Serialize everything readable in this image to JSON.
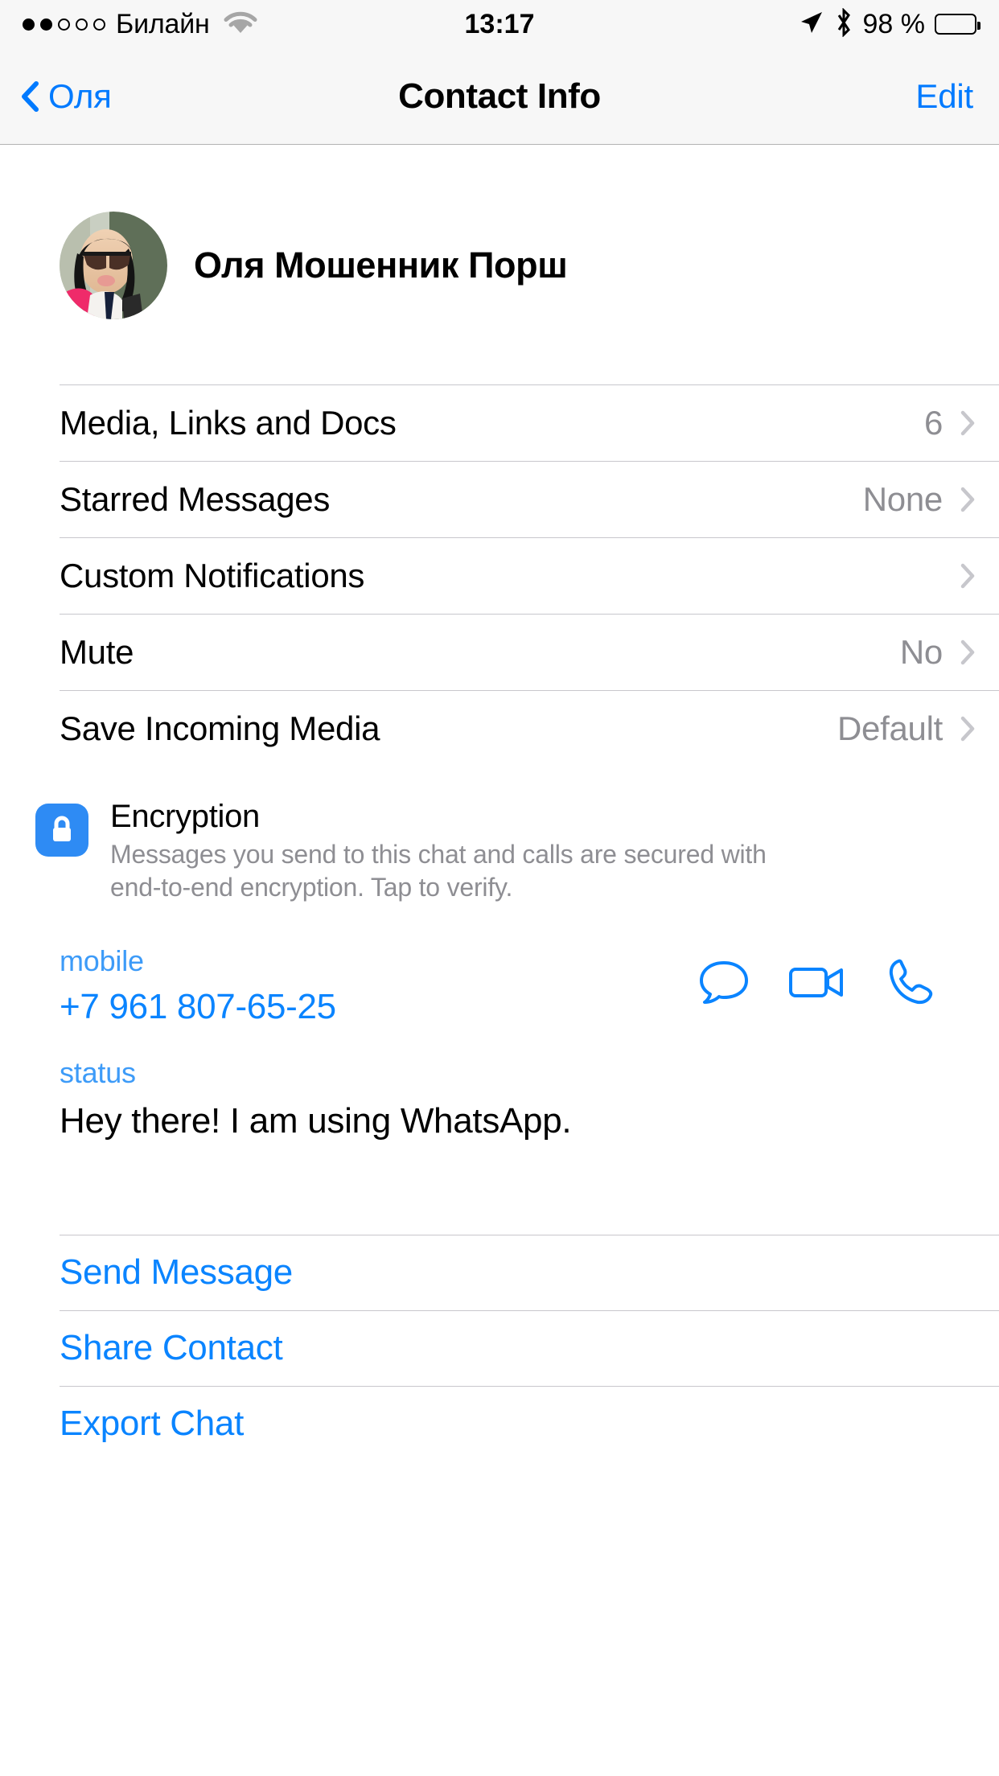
{
  "status_bar": {
    "signal_dots_filled": 2,
    "signal_dots_total": 5,
    "carrier": "Билайн",
    "wifi_icon": "wifi-icon",
    "time": "13:17",
    "location_icon": "location-arrow-icon",
    "bluetooth_icon": "bluetooth-icon",
    "battery_percent": "98 %",
    "battery_icon": "battery-full-icon"
  },
  "nav_bar": {
    "back_icon": "chevron-left-icon",
    "back_label": "Оля",
    "title": "Contact Info",
    "edit_label": "Edit"
  },
  "contact": {
    "avatar_name": "avatar",
    "name": "Оля Мошенник Порш"
  },
  "rows": [
    {
      "label": "Media, Links and Docs",
      "value": "6",
      "chevron": "chevron-right-icon"
    },
    {
      "label": "Starred Messages",
      "value": "None",
      "chevron": "chevron-right-icon"
    },
    {
      "label": "Custom Notifications",
      "value": "",
      "chevron": "chevron-right-icon"
    },
    {
      "label": "Mute",
      "value": "No",
      "chevron": "chevron-right-icon"
    },
    {
      "label": "Save Incoming Media",
      "value": "Default",
      "chevron": "chevron-right-icon"
    }
  ],
  "encryption": {
    "icon": "lock-icon",
    "title": "Encryption",
    "description": "Messages you send to this chat and calls are secured with end-to-end encryption. Tap to verify."
  },
  "phone": {
    "label": "mobile",
    "number": "+7 961 807-65-25",
    "actions": [
      {
        "name": "message-icon"
      },
      {
        "name": "video-call-icon"
      },
      {
        "name": "voice-call-icon"
      }
    ]
  },
  "status": {
    "label": "status",
    "text": "Hey there! I am using WhatsApp."
  },
  "actions": [
    {
      "label": "Send Message"
    },
    {
      "label": "Share Contact"
    },
    {
      "label": "Export Chat"
    }
  ],
  "colors": {
    "accent_blue": "#0a84ff",
    "nav_blue": "#007aff",
    "lock_blue": "#2e8bf4",
    "secondary_text": "#8e8e93",
    "divider": "#c8c7cc",
    "bar_bg": "#f7f7f7"
  }
}
